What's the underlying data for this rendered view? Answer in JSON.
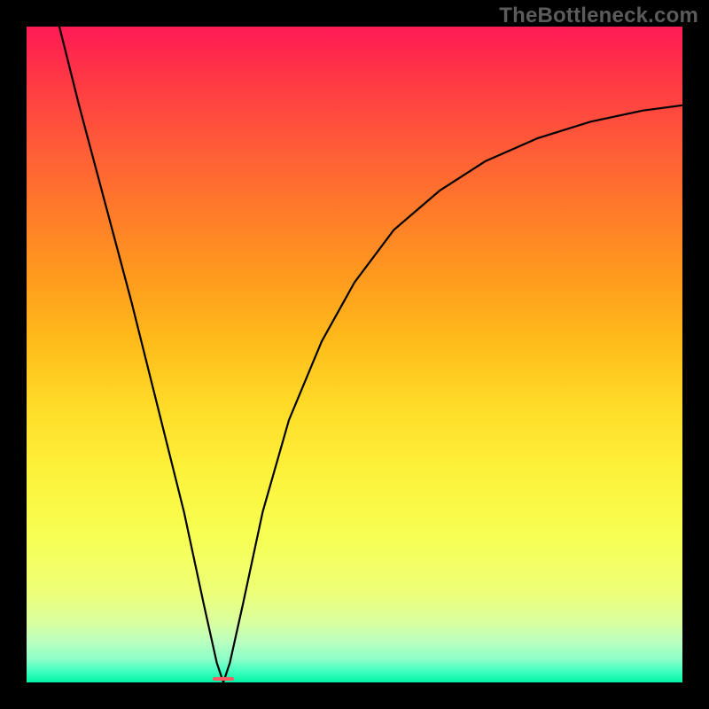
{
  "watermark": "TheBottleneck.com",
  "chart_data": {
    "type": "line",
    "title": "",
    "xlabel": "",
    "ylabel": "",
    "x_range": [
      0,
      100
    ],
    "y_range": [
      0,
      100
    ],
    "notch_x": 30,
    "series": [
      {
        "name": "bottleneck-curve",
        "points": [
          {
            "x": 5,
            "y": 100
          },
          {
            "x": 8,
            "y": 88
          },
          {
            "x": 12,
            "y": 73
          },
          {
            "x": 16,
            "y": 58
          },
          {
            "x": 20,
            "y": 42
          },
          {
            "x": 24,
            "y": 26
          },
          {
            "x": 27,
            "y": 12
          },
          {
            "x": 29,
            "y": 3
          },
          {
            "x": 30,
            "y": 0
          },
          {
            "x": 31,
            "y": 3
          },
          {
            "x": 33,
            "y": 12
          },
          {
            "x": 36,
            "y": 26
          },
          {
            "x": 40,
            "y": 40
          },
          {
            "x": 45,
            "y": 52
          },
          {
            "x": 50,
            "y": 61
          },
          {
            "x": 56,
            "y": 69
          },
          {
            "x": 63,
            "y": 75
          },
          {
            "x": 70,
            "y": 79.5
          },
          {
            "x": 78,
            "y": 83
          },
          {
            "x": 86,
            "y": 85.5
          },
          {
            "x": 94,
            "y": 87.2
          },
          {
            "x": 100,
            "y": 88
          }
        ]
      }
    ],
    "marker": {
      "x": 30,
      "y": 0,
      "label": ""
    },
    "gradient_stops": [
      {
        "pos": 0,
        "color": "#ff1a54"
      },
      {
        "pos": 50,
        "color": "#ffdc28"
      },
      {
        "pos": 100,
        "color": "#00f4a8"
      }
    ]
  }
}
